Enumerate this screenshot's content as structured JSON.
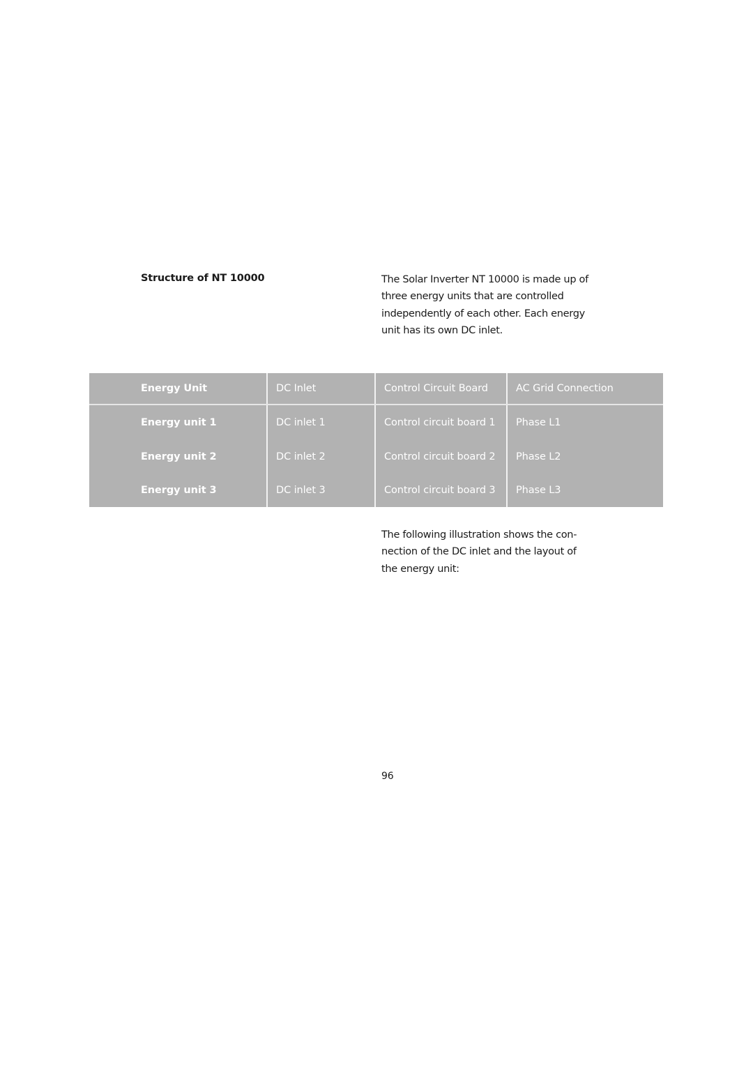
{
  "section": {
    "title": "Structure of NT 10000",
    "intro_lines": [
      "The Solar Inverter NT 10000 is made up of",
      "three energy units that are controlled",
      "independently of each other. Each energy",
      "unit has its own DC inlet."
    ]
  },
  "table": {
    "headers": [
      "Energy Unit",
      "DC Inlet",
      "Control Circuit Board",
      "AC Grid Connection"
    ],
    "rows": [
      [
        "Energy unit 1",
        "DC inlet 1",
        "Control circuit board 1",
        "Phase L1"
      ],
      [
        "Energy unit 2",
        "DC inlet 2",
        "Control circuit board 2",
        "Phase L2"
      ],
      [
        "Energy unit 3",
        "DC inlet 3",
        "Control circuit board 3",
        "Phase L3"
      ]
    ],
    "background_color": "#b2b2b2",
    "text_color": "#ffffff"
  },
  "follow_text_lines": [
    "The following illustration shows the con-",
    "nection of the DC inlet and the layout of",
    "the energy unit:"
  ],
  "page_number": "96"
}
